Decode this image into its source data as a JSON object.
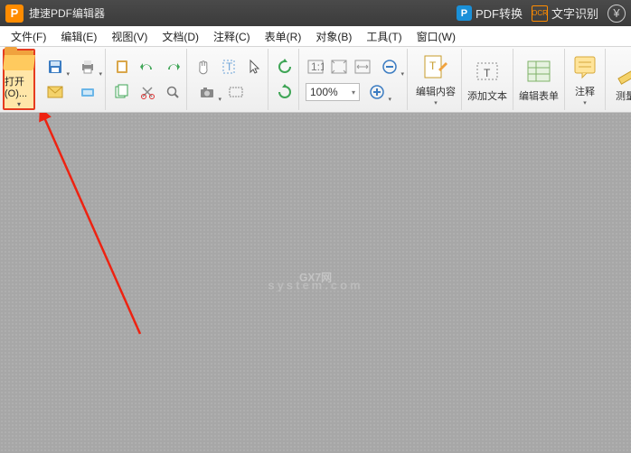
{
  "titlebar": {
    "app_badge": "P",
    "title": "捷速PDF编辑器",
    "convert_badge": "P",
    "convert_label": "PDF转换",
    "ocr_badge": "OCR",
    "ocr_label": "文字识别",
    "yen": "¥"
  },
  "menus": {
    "file": "文件(F)",
    "edit": "编辑(E)",
    "view": "视图(V)",
    "document": "文档(D)",
    "comment": "注释(C)",
    "form": "表单(R)",
    "object": "对象(B)",
    "tool": "工具(T)",
    "window": "窗口(W)"
  },
  "toolbar": {
    "open_label": "打开(O)...",
    "zoom_value": "100%",
    "edit_content": "编辑内容",
    "add_text": "添加文本",
    "edit_form": "编辑表单",
    "annotate": "注释",
    "measure": "测量"
  },
  "watermark": {
    "main": "GX7网",
    "sub": "system.com"
  },
  "dd_glyph": "▾"
}
